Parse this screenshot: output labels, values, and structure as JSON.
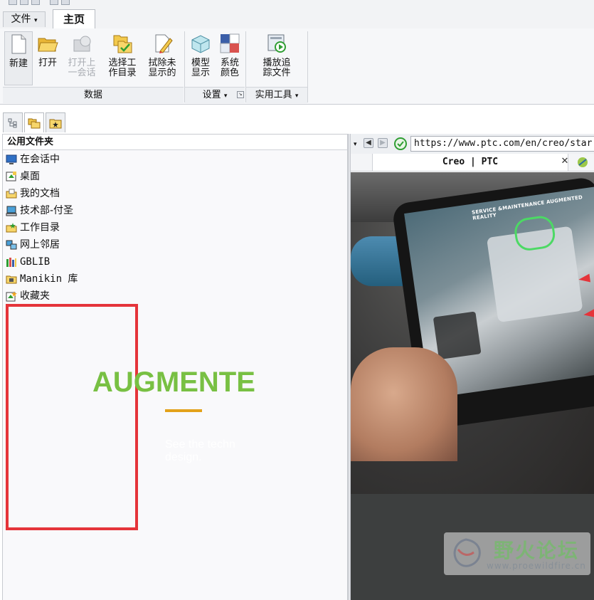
{
  "menu": {
    "file_tab": "文件",
    "home_tab": "主页"
  },
  "ribbon": {
    "buttons": {
      "new": "新建",
      "open": "打开",
      "open_last_line1": "打开上",
      "open_last_line2": "一会话",
      "select_dir_line1": "选择工",
      "select_dir_line2": "作目录",
      "erase_line1": "拭除未",
      "erase_line2": "显示的",
      "model_display_line1": "模型",
      "model_display_line2": "显示",
      "system_colors_line1": "系统",
      "system_colors_line2": "颜色",
      "playback_line1": "播放追",
      "playback_line2": "踪文件"
    },
    "groups": {
      "data": "数据",
      "settings": "设置",
      "utilities": "实用工具"
    }
  },
  "navigator": {
    "header": "公用文件夹",
    "items": [
      {
        "label": "在会话中",
        "icon": "monitor-icon"
      },
      {
        "label": "桌面",
        "icon": "desktop-icon"
      },
      {
        "label": "我的文档",
        "icon": "documents-folder-icon"
      },
      {
        "label": "技术部-付圣",
        "icon": "computer-icon"
      },
      {
        "label": "工作目录",
        "icon": "working-folder-icon"
      },
      {
        "label": "网上邻居",
        "icon": "network-icon"
      },
      {
        "label": "GBLIB",
        "icon": "library-icon"
      },
      {
        "label": "Manikin 库",
        "icon": "manikin-folder-icon"
      },
      {
        "label": "收藏夹",
        "icon": "favorites-icon"
      }
    ]
  },
  "browser": {
    "url": "https://www.ptc.com/en/creo/star",
    "tab_title": "Creo | PTC",
    "hero_caption": "SERVICE &MAINTENANCE  AUGMENTED REALITY",
    "headline": "AUGMENTE",
    "subtext_line1": "See the techn",
    "subtext_line2": "design."
  },
  "watermark": {
    "text": "野火论坛",
    "url": "www.proewildfire.cn"
  },
  "colors": {
    "highlight_box": "#e5343a",
    "headline_green": "#78c043",
    "accent_gold": "#e3a21a"
  }
}
